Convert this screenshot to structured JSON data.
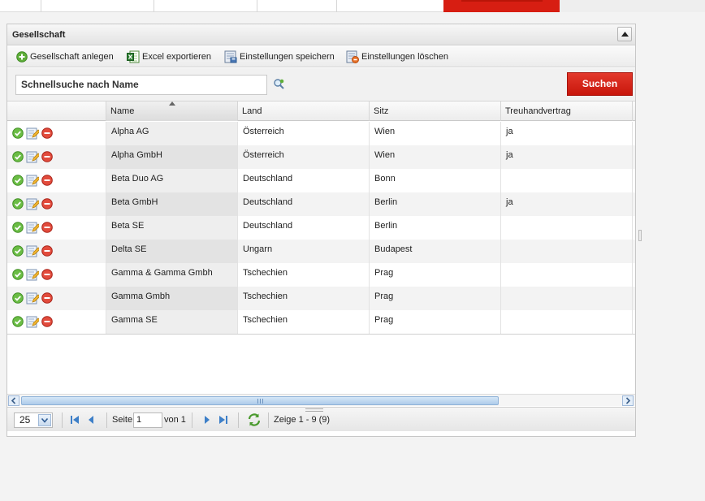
{
  "panel": {
    "title": "Gesellschaft"
  },
  "toolbar": {
    "add_label": "Gesellschaft anlegen",
    "excel_label": "Excel exportieren",
    "save_label": "Einstellungen speichern",
    "delete_label": "Einstellungen löschen"
  },
  "search": {
    "value": "Schnellsuche nach Name",
    "button_label": "Suchen"
  },
  "grid": {
    "columns": [
      "Name",
      "Land",
      "Sitz",
      "Treuhandvertrag"
    ],
    "sorted_column": "Name",
    "rows": [
      {
        "name": "Alpha AG",
        "land": "Österreich",
        "sitz": "Wien",
        "treuhand": "ja"
      },
      {
        "name": "Alpha GmbH",
        "land": "Österreich",
        "sitz": "Wien",
        "treuhand": "ja"
      },
      {
        "name": "Beta Duo AG",
        "land": "Deutschland",
        "sitz": "Bonn",
        "treuhand": ""
      },
      {
        "name": "Beta GmbH",
        "land": "Deutschland",
        "sitz": "Berlin",
        "treuhand": "ja"
      },
      {
        "name": "Beta SE",
        "land": "Deutschland",
        "sitz": "Berlin",
        "treuhand": ""
      },
      {
        "name": "Delta SE",
        "land": "Ungarn",
        "sitz": "Budapest",
        "treuhand": ""
      },
      {
        "name": "Gamma & Gamma Gmbh",
        "land": "Tschechien",
        "sitz": "Prag",
        "treuhand": ""
      },
      {
        "name": "Gamma Gmbh",
        "land": "Tschechien",
        "sitz": "Prag",
        "treuhand": ""
      },
      {
        "name": "Gamma SE",
        "land": "Tschechien",
        "sitz": "Prag",
        "treuhand": ""
      }
    ],
    "row_actions": [
      "check-icon",
      "edit-icon",
      "delete-icon"
    ]
  },
  "pager": {
    "page_size": "25",
    "page_label": "Seite",
    "current_page": "1",
    "of_label": "von 1",
    "summary": "Zeige 1 - 9 (9)"
  },
  "colors": {
    "accent_red": "#d71e12",
    "button_red": "#c8160b",
    "scroll_blue": "#aecbea"
  }
}
